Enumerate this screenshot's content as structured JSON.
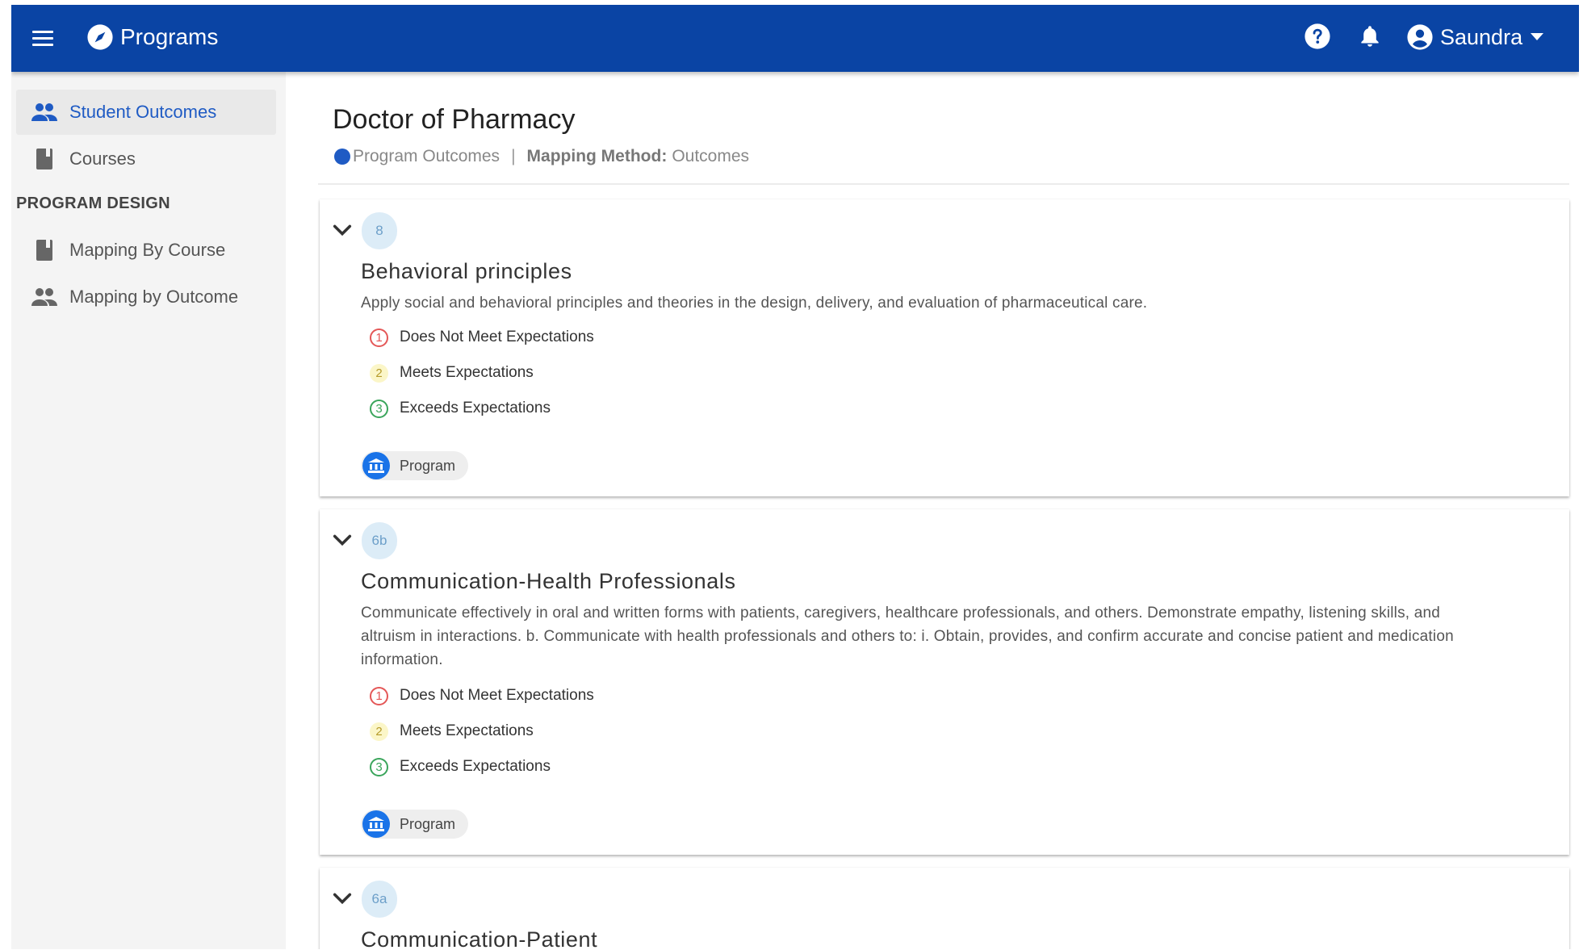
{
  "header": {
    "app_title": "Programs",
    "user_name": "Saundra",
    "icons": {
      "menu": "menu-icon",
      "app": "compass-icon",
      "help": "help-icon",
      "notifications": "bell-icon",
      "account": "account-circle-icon",
      "caret": "caret-down-icon"
    }
  },
  "sidebar": {
    "items": [
      {
        "label": "Student Outcomes",
        "icon": "people-icon",
        "active": true
      },
      {
        "label": "Courses",
        "icon": "book-icon",
        "active": false
      }
    ],
    "section_label": "PROGRAM DESIGN",
    "design_items": [
      {
        "label": "Mapping By Course",
        "icon": "book-icon"
      },
      {
        "label": "Mapping by Outcome",
        "icon": "people-icon"
      }
    ]
  },
  "main": {
    "title": "Doctor of Pharmacy",
    "subtitle": {
      "context": "Program Outcomes",
      "separator": "|",
      "method_label": "Mapping Method:",
      "method_value": "Outcomes"
    },
    "outcomes": [
      {
        "number": "8",
        "title": "Behavioral principles",
        "description": "Apply social and behavioral principles and theories in the design, delivery, and evaluation of pharmaceutical care.",
        "levels": [
          {
            "num": "1",
            "label": "Does Not Meet Expectations"
          },
          {
            "num": "2",
            "label": "Meets Expectations"
          },
          {
            "num": "3",
            "label": "Exceeds Expectations"
          }
        ],
        "chip": "Program"
      },
      {
        "number": "6b",
        "title": "Communication-Health Professionals",
        "description": "Communicate effectively in oral and written forms with patients, caregivers, healthcare professionals, and others. Demonstrate empathy, listening skills, and altruism in interactions. b. Communicate with health professionals and others to: i. Obtain, provides, and confirm accurate and concise patient and medication information.",
        "levels": [
          {
            "num": "1",
            "label": "Does Not Meet Expectations"
          },
          {
            "num": "2",
            "label": "Meets Expectations"
          },
          {
            "num": "3",
            "label": "Exceeds Expectations"
          }
        ],
        "chip": "Program"
      },
      {
        "number": "6a",
        "title": "Communication-Patient"
      }
    ]
  },
  "colors": {
    "header_bg": "#0a44a4",
    "accent": "#1f5bc4",
    "level_1": "#e45757",
    "level_2": "#fbf6c8",
    "level_3": "#3aa55b",
    "badge_bg": "#dcecf7"
  }
}
